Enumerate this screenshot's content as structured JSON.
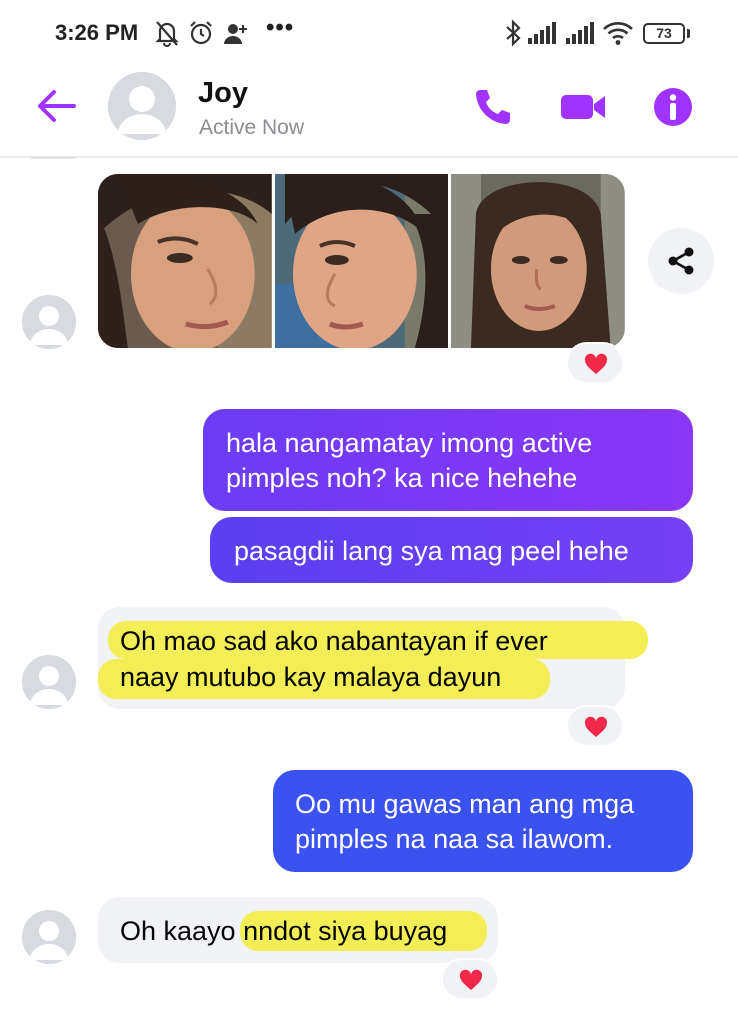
{
  "status_bar": {
    "time": "3:26 PM",
    "battery": "73",
    "more": "•••",
    "icons": [
      "mute-bell-icon",
      "alarm-icon",
      "add-user-icon",
      "bluetooth-icon",
      "signal-icon",
      "signal-icon",
      "wifi-icon",
      "battery-icon"
    ]
  },
  "header": {
    "name": "Joy",
    "status": "Active Now",
    "icons": [
      "back-arrow-icon",
      "phone-icon",
      "video-camera-icon",
      "info-icon"
    ]
  },
  "colors": {
    "accent": "#a033ff",
    "bubble_purple": "#7b3cf5",
    "bubble_blue": "#3a52f0",
    "incoming_bg": "#f0f2f5",
    "highlight": "#f3ee56",
    "heart": "#f02849"
  },
  "messages": [
    {
      "from": "contact",
      "type": "photos",
      "count": 3,
      "reaction": "heart"
    },
    {
      "from": "me",
      "lines": [
        "hala nangamatay imong active",
        "pimples noh? ka nice hehehe"
      ]
    },
    {
      "from": "me",
      "lines": [
        "pasagdii lang sya mag peel hehe"
      ]
    },
    {
      "from": "contact",
      "lines": [
        "Oh mao sad ako nabantayan if ever",
        "naay mutubo kay malaya dayun"
      ],
      "reaction": "heart"
    },
    {
      "from": "me",
      "lines": [
        "Oo mu gawas man ang mga",
        "pimples na naa sa ilawom."
      ]
    },
    {
      "from": "contact",
      "lines": [
        "Oh kaayo nndot siya buyag"
      ],
      "reaction": "heart"
    }
  ]
}
